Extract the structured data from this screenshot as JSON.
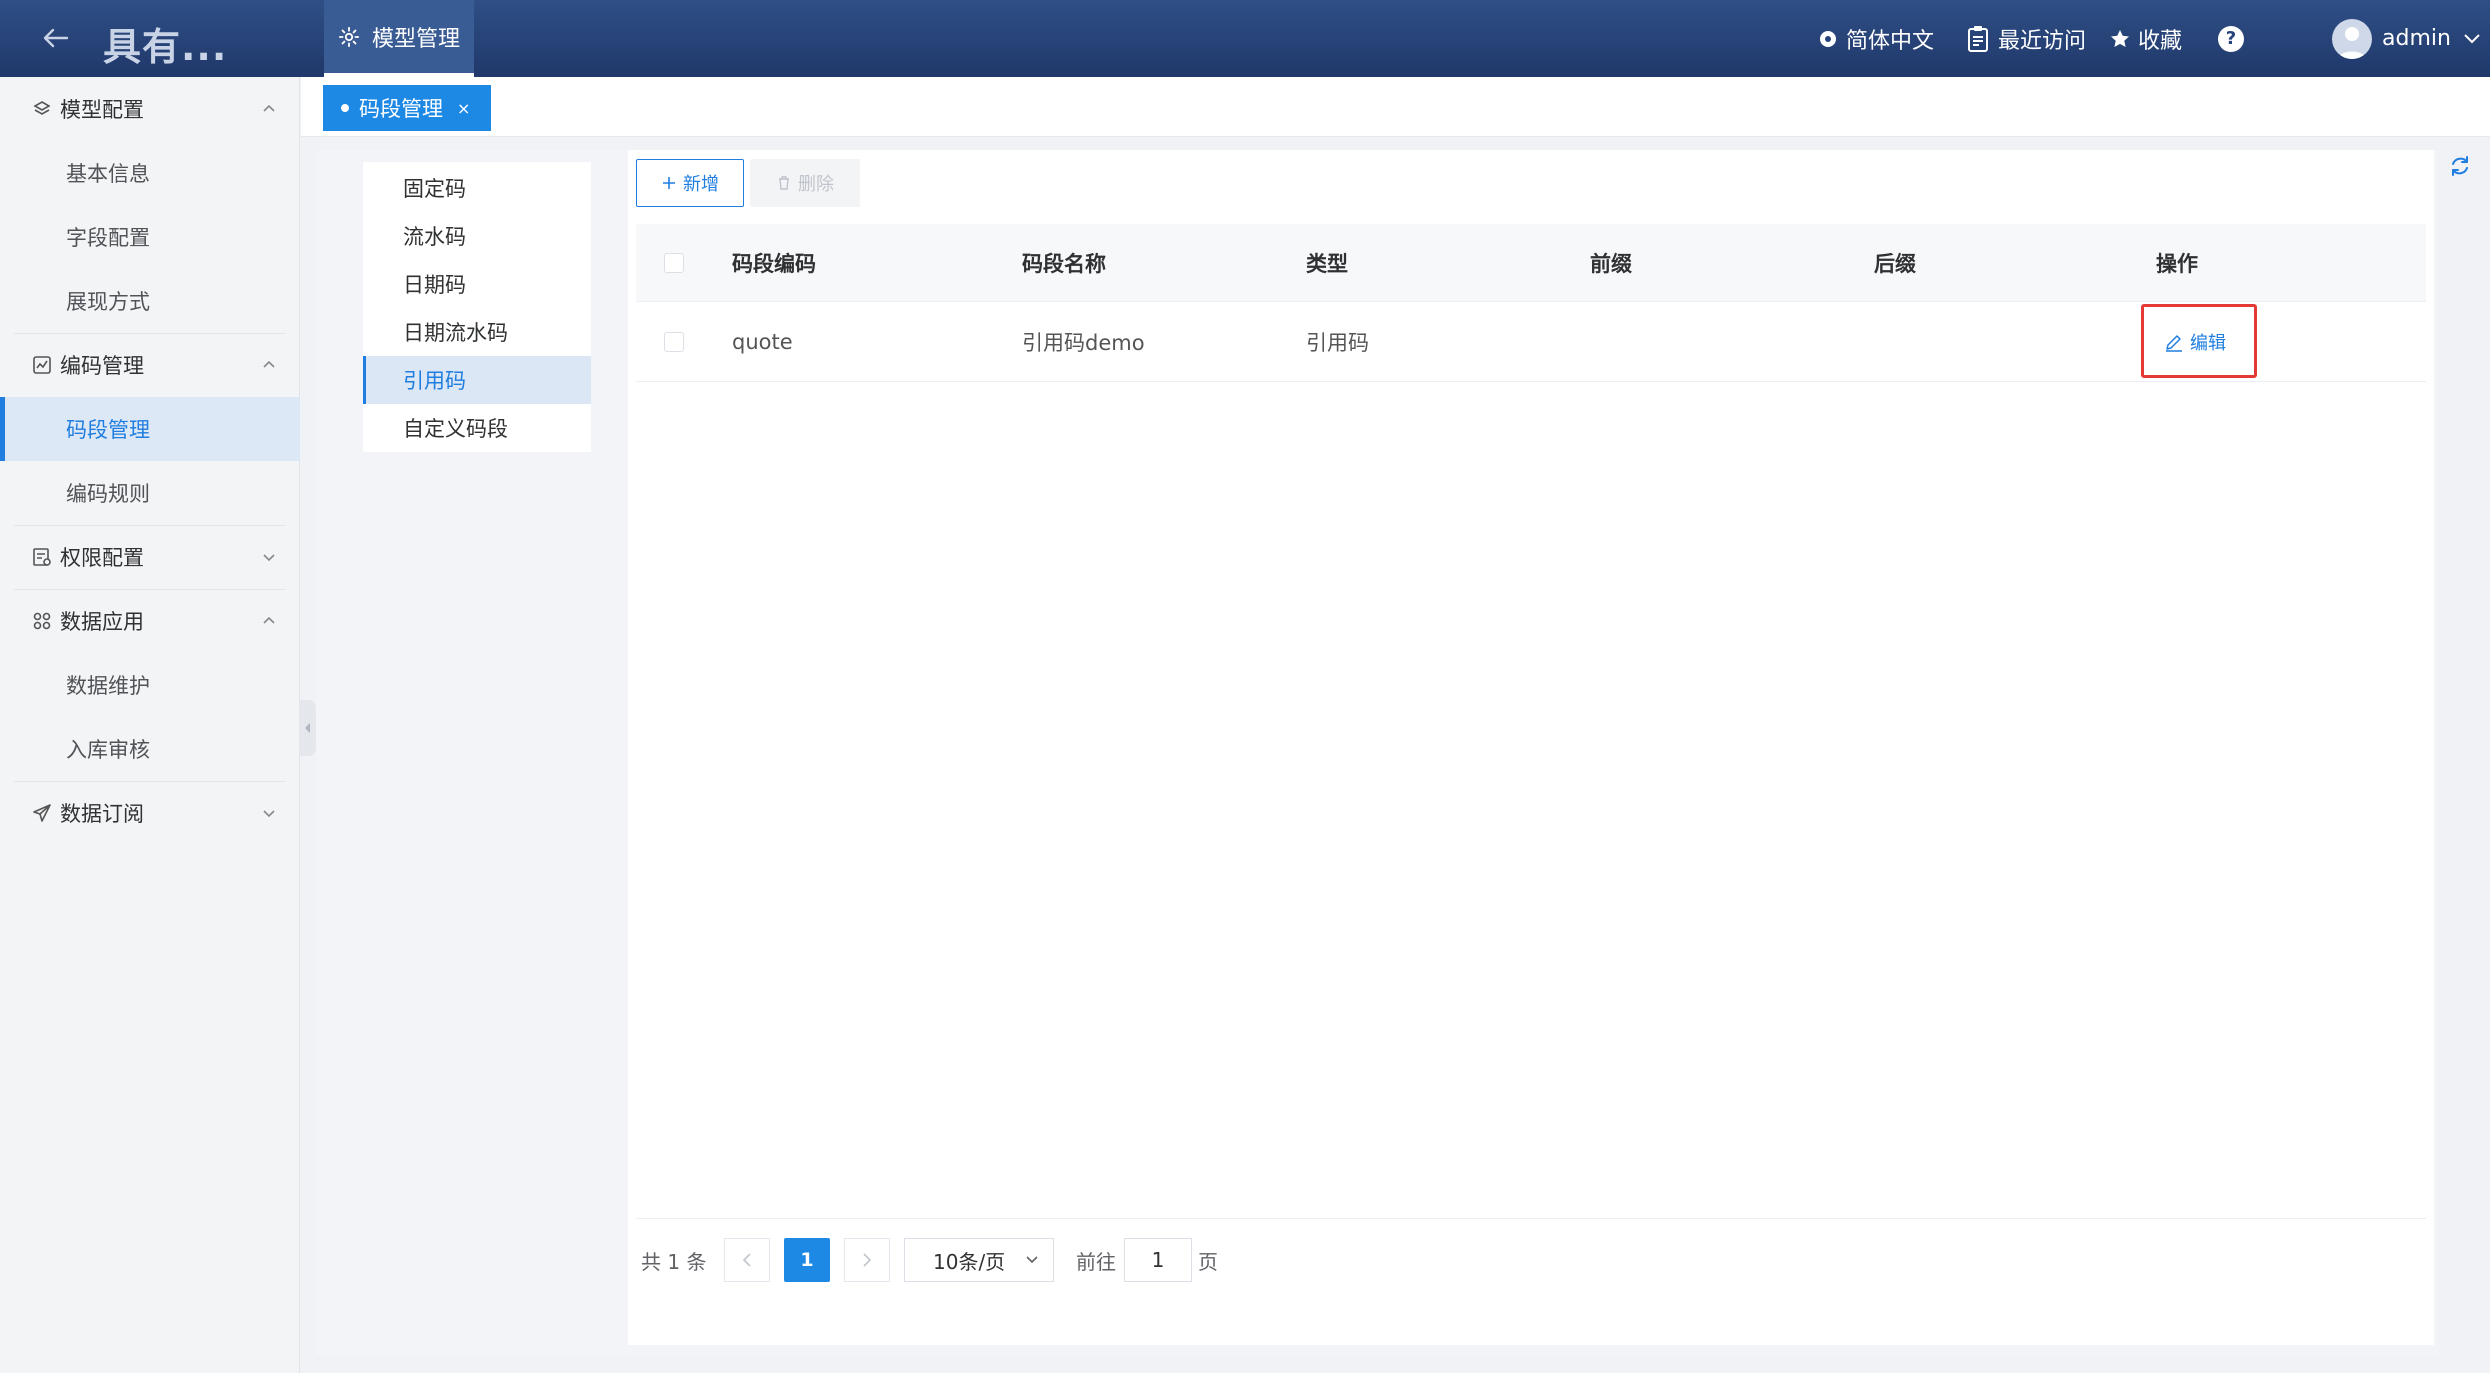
{
  "header": {
    "app_title": "具有...",
    "active_tab": "模型管理",
    "language": "简体中文",
    "recent": "最近访问",
    "favorites": "收藏",
    "user": "admin"
  },
  "sidebar": {
    "groups": [
      {
        "label": "模型配置",
        "items": [
          "基本信息",
          "字段配置",
          "展现方式"
        ]
      },
      {
        "label": "编码管理",
        "items": [
          "码段管理",
          "编码规则"
        ]
      },
      {
        "label": "权限配置",
        "items": []
      },
      {
        "label": "数据应用",
        "items": [
          "数据维护",
          "入库审核"
        ]
      },
      {
        "label": "数据订阅",
        "items": []
      }
    ],
    "active_item": "码段管理"
  },
  "page_tab": {
    "label": "码段管理",
    "close": "×"
  },
  "segment_types": [
    "固定码",
    "流水码",
    "日期码",
    "日期流水码",
    "引用码",
    "自定义码段"
  ],
  "active_segment_type": "引用码",
  "toolbar": {
    "add_label": "新增",
    "delete_label": "删除"
  },
  "table": {
    "columns": [
      "码段编码",
      "码段名称",
      "类型",
      "前缀",
      "后缀",
      "操作"
    ],
    "rows": [
      {
        "code": "quote",
        "name": "引用码demo",
        "type": "引用码",
        "prefix": "",
        "suffix": "",
        "action": "编辑"
      }
    ]
  },
  "pagination": {
    "total": "共 1 条",
    "current_page": "1",
    "page_size": "10条/页",
    "goto_prefix": "前往",
    "goto_value": "1",
    "goto_suffix": "页"
  },
  "colors": {
    "primary": "#1f7ee0",
    "header": "#27427a",
    "highlight": "#e53935"
  }
}
